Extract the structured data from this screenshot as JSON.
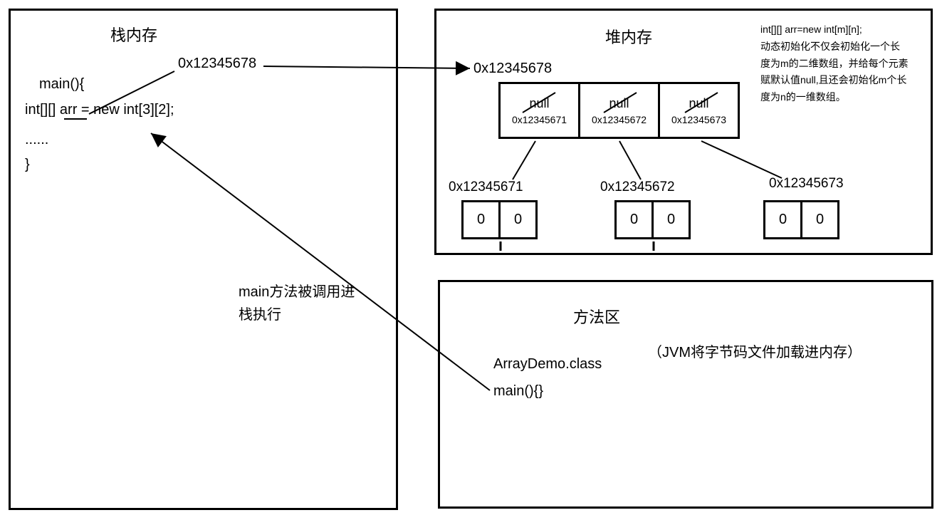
{
  "stack": {
    "title": "栈内存",
    "addr": "0x12345678",
    "line1": "main(){",
    "line2": "int[][] arr = new int[3][2];",
    "line3": "......",
    "line4": "}"
  },
  "heap": {
    "title": "堆内存",
    "addr": "0x12345678",
    "outer": [
      {
        "null": "null",
        "addr": "0x12345671"
      },
      {
        "null": "null",
        "addr": "0x12345672"
      },
      {
        "null": "null",
        "addr": "0x12345673"
      }
    ],
    "subs": [
      {
        "label": "0x12345671",
        "cells": [
          "0",
          "0"
        ]
      },
      {
        "label": "0x12345672",
        "cells": [
          "0",
          "0"
        ]
      },
      {
        "label": "0x12345673",
        "cells": [
          "0",
          "0"
        ]
      }
    ]
  },
  "methodArea": {
    "title": "方法区",
    "class": "ArrayDemo.class",
    "main": "main(){}",
    "note": "（JVM将字节码文件加载进内存）"
  },
  "caption": {
    "line1": "main方法被调用进",
    "line2": "栈执行"
  },
  "sidenote": {
    "l1": "int[][] arr=new int[m][n];",
    "l2": "动态初始化不仅会初始化一个长",
    "l3": "度为m的二维数组，并给每个元素",
    "l4": "赋默认值null,且还会初始化m个长",
    "l5": "度为n的一维数组。"
  }
}
